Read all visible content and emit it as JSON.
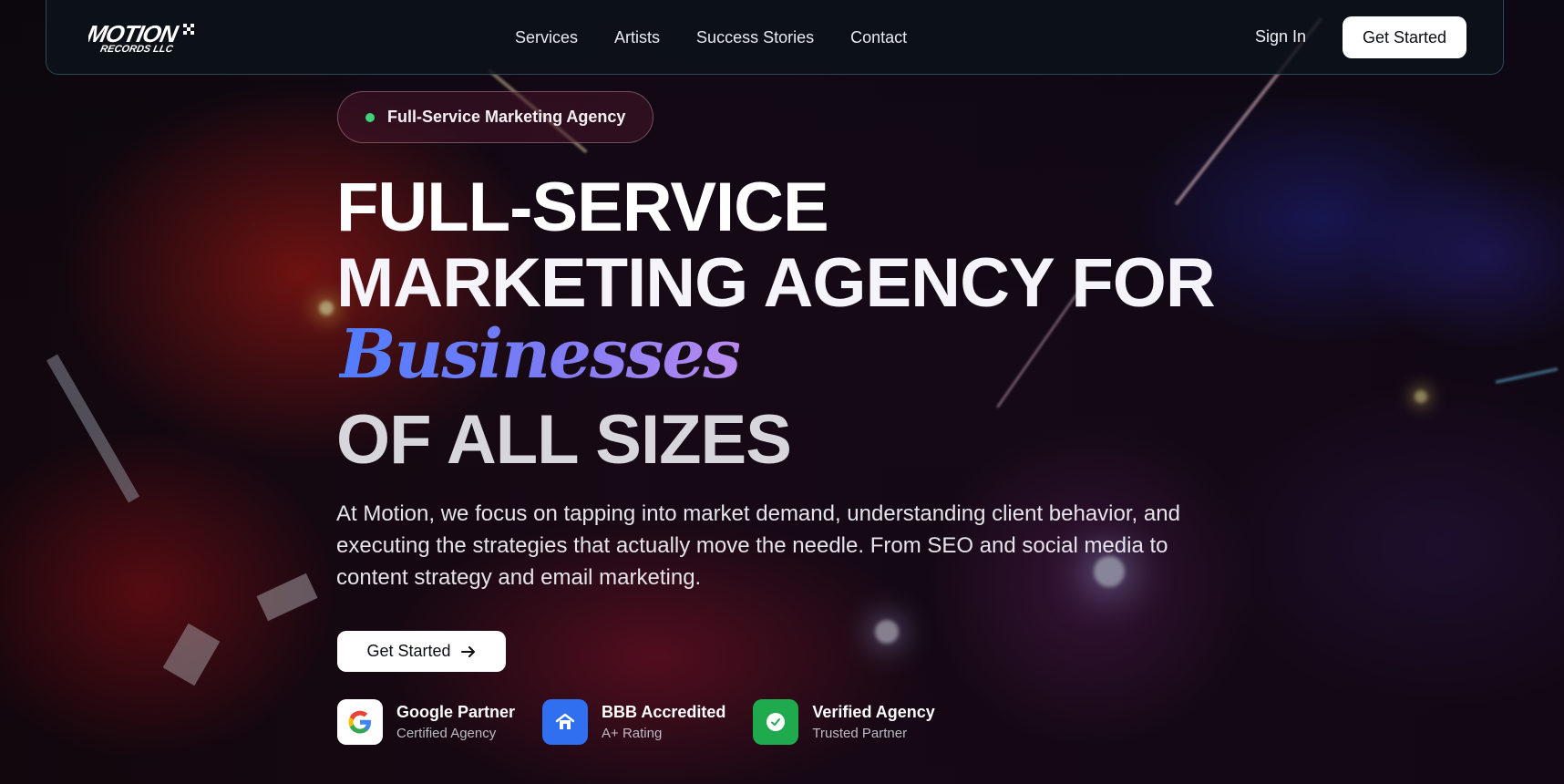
{
  "nav": {
    "logo_text": "MOTION RECORDS LLC",
    "links": [
      "Services",
      "Artists",
      "Success Stories",
      "Contact"
    ],
    "sign_in": "Sign In",
    "cta": "Get Started"
  },
  "hero": {
    "pill": "Full-Service Marketing Agency",
    "line1": "FULL-SERVICE",
    "line2": "MARKETING AGENCY FOR",
    "script": "Businesses",
    "line4": "OF ALL SIZES",
    "lead": "At Motion, we focus on tapping into market demand, understanding client behavior, and executing the strategies that actually move the needle. From SEO and social media to content strategy and email marketing.",
    "cta": "Get Started"
  },
  "badges": [
    {
      "title": "Google Partner",
      "sub": "Certified Agency",
      "icon": "google-icon"
    },
    {
      "title": "BBB Accredited",
      "sub": "A+ Rating",
      "icon": "home-icon"
    },
    {
      "title": "Verified Agency",
      "sub": "Trusted Partner",
      "icon": "check-circle-icon"
    }
  ],
  "colors": {
    "accent_gradient": [
      "#4f7dff",
      "#b88af0"
    ],
    "status_dot": "#3fd07a",
    "bbb_blue": "#2f6ff0",
    "verified_green": "#1faa4d"
  }
}
